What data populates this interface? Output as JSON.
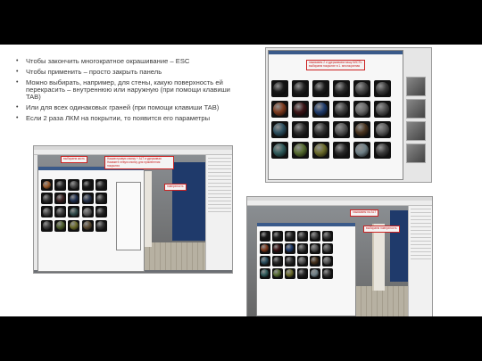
{
  "bullets": [
    "Чтобы закончить многократное окрашивание – ESC",
    "Чтобы применить – просто закрыть панель",
    "Можно выбирать, например, для стены, какую поверхность ей перекрасить – внутреннюю или наружную (при помощи клавиши TAB)",
    "Или для всех одинаковых граней (при помощи клавиши TAB)",
    "Если 2 раза ЛКМ на покрытии, то появится его параметры"
  ],
  "callouts": {
    "top": [
      "нажимаем 2 и удерживаем нашу КИСТЬ",
      "выбираем покрытие в 1. многократная"
    ],
    "left_a": "выбираем кисть",
    "left_b": "Нажав правую кнопку + ALT и удерживая Нажмите левую кнопку для применения покрытия",
    "left_c": "поверхность",
    "right_a": "нажимаем на ALT",
    "right_b": "выбираем поверхность"
  },
  "colors": {
    "callout_red": "#cc2222",
    "wall_blue": "#1f3a6b"
  },
  "materials": {
    "top": [
      "#1a1a1a",
      "#222",
      "#1b1b1b",
      "#2a2a2a",
      "#444",
      "#3a3a3a",
      "#7d3a1e",
      "#3b1416",
      "#1e3a6b",
      "#3e3e3e",
      "#666",
      "#4d4d4d",
      "#2c4f5f",
      "#2c2c2c",
      "#333",
      "#555",
      "#4a3520",
      "#5a5a5a",
      "#2f5a5a",
      "#556b2f",
      "#6b6b2a",
      "#2a2a2a",
      "#6e7f86",
      "#3a3a3a"
    ],
    "left": [
      "#9a5a2a",
      "#2a2a2a",
      "#444",
      "#1c1c1c",
      "#2a2a2a",
      "#333",
      "#3a2020",
      "#1e2e4e",
      "#26324a",
      "#2c2c2c",
      "#444",
      "#383838",
      "#2e4a4a",
      "#5a5a5a",
      "#2a2a2a",
      "#3e3e3e",
      "#4a5a2a",
      "#6b6b2a",
      "#5a4a30",
      "#333"
    ],
    "right": [
      "#1a1a1a",
      "#222",
      "#2a2a2a",
      "#333",
      "#444",
      "#3a3a3a",
      "#7d3a1e",
      "#3b1416",
      "#1e3a6b",
      "#3e3e3e",
      "#555",
      "#4d4d4d",
      "#2c4f5f",
      "#2c2c2c",
      "#333",
      "#555",
      "#4a3520",
      "#5a5a5a",
      "#2f5a5a",
      "#556b2f",
      "#6b6b2a",
      "#2a2a2a",
      "#6e7f86",
      "#3a3a3a"
    ]
  }
}
